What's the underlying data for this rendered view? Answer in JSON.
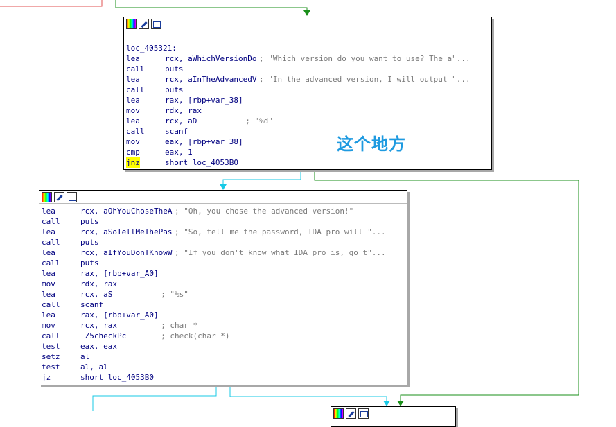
{
  "annotation": {
    "text": "这个地方"
  },
  "node1": {
    "label": "loc_405321:",
    "lines": [
      {
        "m": "lea",
        "o": "rcx, aWhichVersionDo",
        "c": "; \"Which version do you want to use? The a\"..."
      },
      {
        "m": "call",
        "o": "puts",
        "c": ""
      },
      {
        "m": "lea",
        "o": "rcx, aInTheAdvancedV",
        "c": "; \"In the advanced version, I will output \"..."
      },
      {
        "m": "call",
        "o": "puts",
        "c": ""
      },
      {
        "m": "lea",
        "o": "rax, [rbp+var_38]",
        "c": ""
      },
      {
        "m": "mov",
        "o": "rdx, rax",
        "c": ""
      },
      {
        "m": "lea",
        "o": "rcx, aD",
        "c": "; \"%d\""
      },
      {
        "m": "call",
        "o": "scanf",
        "c": ""
      },
      {
        "m": "mov",
        "o": "eax, [rbp+var_38]",
        "c": ""
      },
      {
        "m": "cmp",
        "o": "eax, 1",
        "c": ""
      },
      {
        "m": "jnz",
        "o": "short loc_4053B0",
        "c": ""
      }
    ]
  },
  "node2": {
    "lines": [
      {
        "m": "lea",
        "o": "rcx, aOhYouChoseTheA",
        "c": "; \"Oh, you chose the advanced version!\""
      },
      {
        "m": "call",
        "o": "puts",
        "c": ""
      },
      {
        "m": "lea",
        "o": "rcx, aSoTellMeThePas",
        "c": "; \"So, tell me the password, IDA pro will \"..."
      },
      {
        "m": "call",
        "o": "puts",
        "c": ""
      },
      {
        "m": "lea",
        "o": "rcx, aIfYouDonTKnowW",
        "c": "; \"If you don't know what IDA pro is, go t\"..."
      },
      {
        "m": "call",
        "o": "puts",
        "c": ""
      },
      {
        "m": "lea",
        "o": "rax, [rbp+var_A0]",
        "c": ""
      },
      {
        "m": "mov",
        "o": "rdx, rax",
        "c": ""
      },
      {
        "m": "lea",
        "o": "rcx, aS",
        "c": "; \"%s\""
      },
      {
        "m": "call",
        "o": "scanf",
        "c": ""
      },
      {
        "m": "lea",
        "o": "rax, [rbp+var_A0]",
        "c": ""
      },
      {
        "m": "mov",
        "o": "rcx, rax",
        "c": "; char *"
      },
      {
        "m": "call",
        "o": "_Z5checkPc",
        "c": "; check(char *)"
      },
      {
        "m": "test",
        "o": "eax, eax",
        "c": ""
      },
      {
        "m": "setz",
        "o": "al",
        "c": ""
      },
      {
        "m": "test",
        "o": "al, al",
        "c": ""
      },
      {
        "m": "jz",
        "o": "short loc_4053B0",
        "c": ""
      }
    ]
  },
  "colors": {
    "true_edge": "#2ca02c",
    "false_edge": "#d62728",
    "uncond_edge": "#17c9e6",
    "arrow": "#1e9ae0",
    "highlight": "#ffff00"
  }
}
